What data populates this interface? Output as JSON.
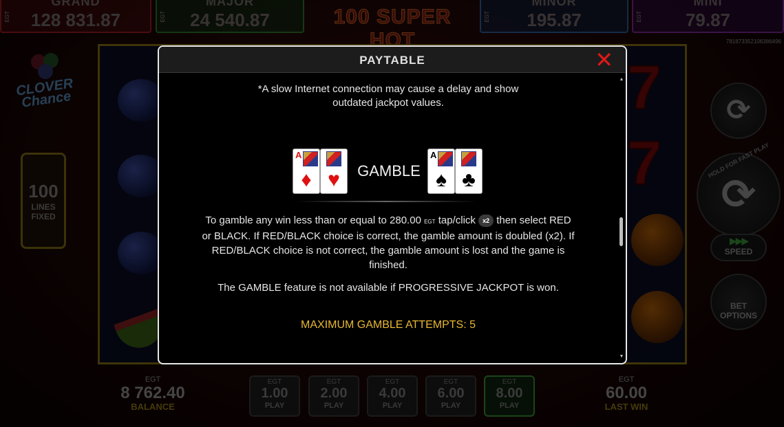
{
  "jackpots": [
    {
      "label": "GRAND",
      "currency": "EGT",
      "value": "128 831.87"
    },
    {
      "label": "MAJOR",
      "currency": "EGT",
      "value": "24 540.87"
    },
    {
      "label": "MINOR",
      "currency": "EGT",
      "value": "195.87"
    },
    {
      "label": "MINI",
      "currency": "EGT",
      "value": "79.87"
    }
  ],
  "game_title": "100 SUPER HOT",
  "game_id": "781873352106386496",
  "logo": {
    "line1": "CLOVER",
    "line2": "Chance"
  },
  "lines": {
    "count": "100",
    "label1": "LINES",
    "label2": "FIXED"
  },
  "right_buttons": {
    "hold_text": "HOLD FOR FAST PLAY",
    "speed": "SPEED",
    "bet_options_1": "BET",
    "bet_options_2": "OPTIONS"
  },
  "bottom": {
    "balance": {
      "currency": "EGT",
      "value": "8 762.40",
      "caption": "BALANCE"
    },
    "last_win": {
      "currency": "EGT",
      "value": "60.00",
      "caption": "LAST WIN"
    },
    "bets": [
      {
        "currency": "EGT",
        "value": "1.00",
        "label": "PLAY"
      },
      {
        "currency": "EGT",
        "value": "2.00",
        "label": "PLAY"
      },
      {
        "currency": "EGT",
        "value": "4.00",
        "label": "PLAY"
      },
      {
        "currency": "EGT",
        "value": "6.00",
        "label": "PLAY"
      },
      {
        "currency": "EGT",
        "value": "8.00",
        "label": "PLAY"
      }
    ]
  },
  "modal": {
    "title": "PAYTABLE",
    "close_symbol": "✕",
    "note_line1": "*A slow Internet connection may cause a delay and show",
    "note_line2": "outdated jackpot values.",
    "gamble_label": "GAMBLE",
    "card_rank": "A",
    "para1_a": "To gamble any win less than or equal to",
    "para1_amount": "280.00",
    "para1_currency": "EGT",
    "para1_b": "tap/click",
    "x2_label": "x2",
    "para1_c": "then select RED or BLACK. If RED/BLACK choice is correct, the gamble amount is doubled (x2). If RED/BLACK choice is not correct, the gamble amount is lost and the game is finished.",
    "para2": "The GAMBLE feature is not available if PROGRESSIVE JACKPOT is won.",
    "max_attempts": "MAXIMUM GAMBLE ATTEMPTS: 5"
  },
  "colors": {
    "close": "#e01818",
    "max_attempts": "#e8b830",
    "red_suit": "#e01010"
  }
}
